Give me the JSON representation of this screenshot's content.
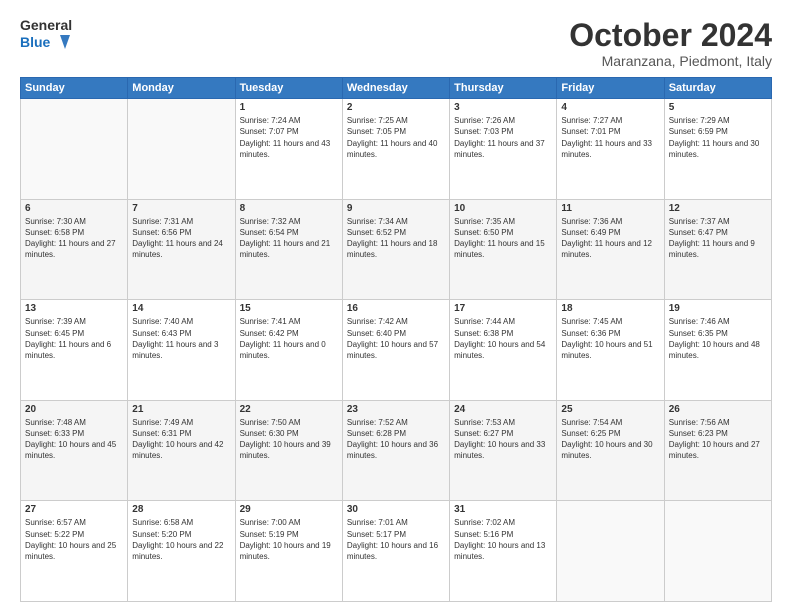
{
  "logo": {
    "line1": "General",
    "line2": "Blue"
  },
  "title": "October 2024",
  "location": "Maranzana, Piedmont, Italy",
  "weekdays": [
    "Sunday",
    "Monday",
    "Tuesday",
    "Wednesday",
    "Thursday",
    "Friday",
    "Saturday"
  ],
  "days": [
    {
      "num": "",
      "info": ""
    },
    {
      "num": "",
      "info": ""
    },
    {
      "num": "1",
      "info": "Sunrise: 7:24 AM\nSunset: 7:07 PM\nDaylight: 11 hours and 43 minutes."
    },
    {
      "num": "2",
      "info": "Sunrise: 7:25 AM\nSunset: 7:05 PM\nDaylight: 11 hours and 40 minutes."
    },
    {
      "num": "3",
      "info": "Sunrise: 7:26 AM\nSunset: 7:03 PM\nDaylight: 11 hours and 37 minutes."
    },
    {
      "num": "4",
      "info": "Sunrise: 7:27 AM\nSunset: 7:01 PM\nDaylight: 11 hours and 33 minutes."
    },
    {
      "num": "5",
      "info": "Sunrise: 7:29 AM\nSunset: 6:59 PM\nDaylight: 11 hours and 30 minutes."
    },
    {
      "num": "6",
      "info": "Sunrise: 7:30 AM\nSunset: 6:58 PM\nDaylight: 11 hours and 27 minutes."
    },
    {
      "num": "7",
      "info": "Sunrise: 7:31 AM\nSunset: 6:56 PM\nDaylight: 11 hours and 24 minutes."
    },
    {
      "num": "8",
      "info": "Sunrise: 7:32 AM\nSunset: 6:54 PM\nDaylight: 11 hours and 21 minutes."
    },
    {
      "num": "9",
      "info": "Sunrise: 7:34 AM\nSunset: 6:52 PM\nDaylight: 11 hours and 18 minutes."
    },
    {
      "num": "10",
      "info": "Sunrise: 7:35 AM\nSunset: 6:50 PM\nDaylight: 11 hours and 15 minutes."
    },
    {
      "num": "11",
      "info": "Sunrise: 7:36 AM\nSunset: 6:49 PM\nDaylight: 11 hours and 12 minutes."
    },
    {
      "num": "12",
      "info": "Sunrise: 7:37 AM\nSunset: 6:47 PM\nDaylight: 11 hours and 9 minutes."
    },
    {
      "num": "13",
      "info": "Sunrise: 7:39 AM\nSunset: 6:45 PM\nDaylight: 11 hours and 6 minutes."
    },
    {
      "num": "14",
      "info": "Sunrise: 7:40 AM\nSunset: 6:43 PM\nDaylight: 11 hours and 3 minutes."
    },
    {
      "num": "15",
      "info": "Sunrise: 7:41 AM\nSunset: 6:42 PM\nDaylight: 11 hours and 0 minutes."
    },
    {
      "num": "16",
      "info": "Sunrise: 7:42 AM\nSunset: 6:40 PM\nDaylight: 10 hours and 57 minutes."
    },
    {
      "num": "17",
      "info": "Sunrise: 7:44 AM\nSunset: 6:38 PM\nDaylight: 10 hours and 54 minutes."
    },
    {
      "num": "18",
      "info": "Sunrise: 7:45 AM\nSunset: 6:36 PM\nDaylight: 10 hours and 51 minutes."
    },
    {
      "num": "19",
      "info": "Sunrise: 7:46 AM\nSunset: 6:35 PM\nDaylight: 10 hours and 48 minutes."
    },
    {
      "num": "20",
      "info": "Sunrise: 7:48 AM\nSunset: 6:33 PM\nDaylight: 10 hours and 45 minutes."
    },
    {
      "num": "21",
      "info": "Sunrise: 7:49 AM\nSunset: 6:31 PM\nDaylight: 10 hours and 42 minutes."
    },
    {
      "num": "22",
      "info": "Sunrise: 7:50 AM\nSunset: 6:30 PM\nDaylight: 10 hours and 39 minutes."
    },
    {
      "num": "23",
      "info": "Sunrise: 7:52 AM\nSunset: 6:28 PM\nDaylight: 10 hours and 36 minutes."
    },
    {
      "num": "24",
      "info": "Sunrise: 7:53 AM\nSunset: 6:27 PM\nDaylight: 10 hours and 33 minutes."
    },
    {
      "num": "25",
      "info": "Sunrise: 7:54 AM\nSunset: 6:25 PM\nDaylight: 10 hours and 30 minutes."
    },
    {
      "num": "26",
      "info": "Sunrise: 7:56 AM\nSunset: 6:23 PM\nDaylight: 10 hours and 27 minutes."
    },
    {
      "num": "27",
      "info": "Sunrise: 6:57 AM\nSunset: 5:22 PM\nDaylight: 10 hours and 25 minutes."
    },
    {
      "num": "28",
      "info": "Sunrise: 6:58 AM\nSunset: 5:20 PM\nDaylight: 10 hours and 22 minutes."
    },
    {
      "num": "29",
      "info": "Sunrise: 7:00 AM\nSunset: 5:19 PM\nDaylight: 10 hours and 19 minutes."
    },
    {
      "num": "30",
      "info": "Sunrise: 7:01 AM\nSunset: 5:17 PM\nDaylight: 10 hours and 16 minutes."
    },
    {
      "num": "31",
      "info": "Sunrise: 7:02 AM\nSunset: 5:16 PM\nDaylight: 10 hours and 13 minutes."
    },
    {
      "num": "",
      "info": ""
    },
    {
      "num": "",
      "info": ""
    }
  ]
}
